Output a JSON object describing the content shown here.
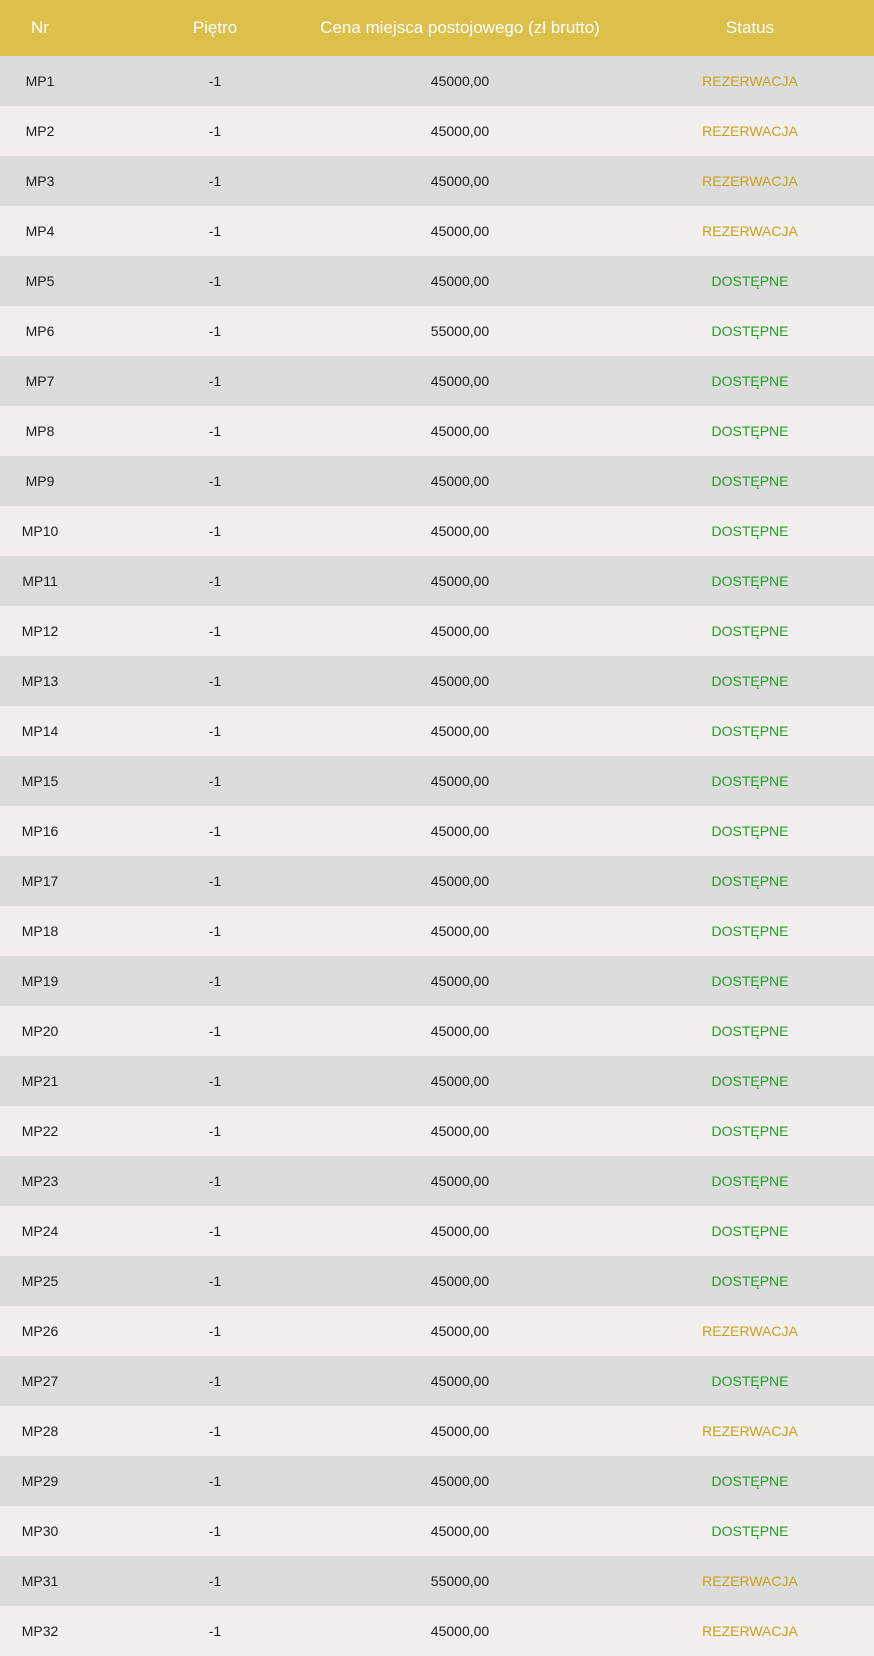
{
  "table": {
    "headers": {
      "nr": "Nr",
      "floor": "Piętro",
      "price": "Cena miejsca postojowego (zł brutto)",
      "status": "Status"
    },
    "rows": [
      {
        "nr": "MP1",
        "floor": "-1",
        "price": "45000,00",
        "status": "REZERWACJA"
      },
      {
        "nr": "MP2",
        "floor": "-1",
        "price": "45000,00",
        "status": "REZERWACJA"
      },
      {
        "nr": "MP3",
        "floor": "-1",
        "price": "45000,00",
        "status": "REZERWACJA"
      },
      {
        "nr": "MP4",
        "floor": "-1",
        "price": "45000,00",
        "status": "REZERWACJA"
      },
      {
        "nr": "MP5",
        "floor": "-1",
        "price": "45000,00",
        "status": "DOSTĘPNE"
      },
      {
        "nr": "MP6",
        "floor": "-1",
        "price": "55000,00",
        "status": "DOSTĘPNE"
      },
      {
        "nr": "MP7",
        "floor": "-1",
        "price": "45000,00",
        "status": "DOSTĘPNE"
      },
      {
        "nr": "MP8",
        "floor": "-1",
        "price": "45000,00",
        "status": "DOSTĘPNE"
      },
      {
        "nr": "MP9",
        "floor": "-1",
        "price": "45000,00",
        "status": "DOSTĘPNE"
      },
      {
        "nr": "MP10",
        "floor": "-1",
        "price": "45000,00",
        "status": "DOSTĘPNE"
      },
      {
        "nr": "MP11",
        "floor": "-1",
        "price": "45000,00",
        "status": "DOSTĘPNE"
      },
      {
        "nr": "MP12",
        "floor": "-1",
        "price": "45000,00",
        "status": "DOSTĘPNE"
      },
      {
        "nr": "MP13",
        "floor": "-1",
        "price": "45000,00",
        "status": "DOSTĘPNE"
      },
      {
        "nr": "MP14",
        "floor": "-1",
        "price": "45000,00",
        "status": "DOSTĘPNE"
      },
      {
        "nr": "MP15",
        "floor": "-1",
        "price": "45000,00",
        "status": "DOSTĘPNE"
      },
      {
        "nr": "MP16",
        "floor": "-1",
        "price": "45000,00",
        "status": "DOSTĘPNE"
      },
      {
        "nr": "MP17",
        "floor": "-1",
        "price": "45000,00",
        "status": "DOSTĘPNE"
      },
      {
        "nr": "MP18",
        "floor": "-1",
        "price": "45000,00",
        "status": "DOSTĘPNE"
      },
      {
        "nr": "MP19",
        "floor": "-1",
        "price": "45000,00",
        "status": "DOSTĘPNE"
      },
      {
        "nr": "MP20",
        "floor": "-1",
        "price": "45000,00",
        "status": "DOSTĘPNE"
      },
      {
        "nr": "MP21",
        "floor": "-1",
        "price": "45000,00",
        "status": "DOSTĘPNE"
      },
      {
        "nr": "MP22",
        "floor": "-1",
        "price": "45000,00",
        "status": "DOSTĘPNE"
      },
      {
        "nr": "MP23",
        "floor": "-1",
        "price": "45000,00",
        "status": "DOSTĘPNE"
      },
      {
        "nr": "MP24",
        "floor": "-1",
        "price": "45000,00",
        "status": "DOSTĘPNE"
      },
      {
        "nr": "MP25",
        "floor": "-1",
        "price": "45000,00",
        "status": "DOSTĘPNE"
      },
      {
        "nr": "MP26",
        "floor": "-1",
        "price": "45000,00",
        "status": "REZERWACJA"
      },
      {
        "nr": "MP27",
        "floor": "-1",
        "price": "45000,00",
        "status": "DOSTĘPNE"
      },
      {
        "nr": "MP28",
        "floor": "-1",
        "price": "45000,00",
        "status": "REZERWACJA"
      },
      {
        "nr": "MP29",
        "floor": "-1",
        "price": "45000,00",
        "status": "DOSTĘPNE"
      },
      {
        "nr": "MP30",
        "floor": "-1",
        "price": "45000,00",
        "status": "DOSTĘPNE"
      },
      {
        "nr": "MP31",
        "floor": "-1",
        "price": "55000,00",
        "status": "REZERWACJA"
      },
      {
        "nr": "MP32",
        "floor": "-1",
        "price": "45000,00",
        "status": "REZERWACJA"
      }
    ]
  },
  "colors": {
    "header_bg": "#dcc04b",
    "row_odd_bg": "#dcdcdc",
    "row_even_bg": "#f2efee",
    "reserved": "#c9a21b",
    "available": "#22a023"
  }
}
